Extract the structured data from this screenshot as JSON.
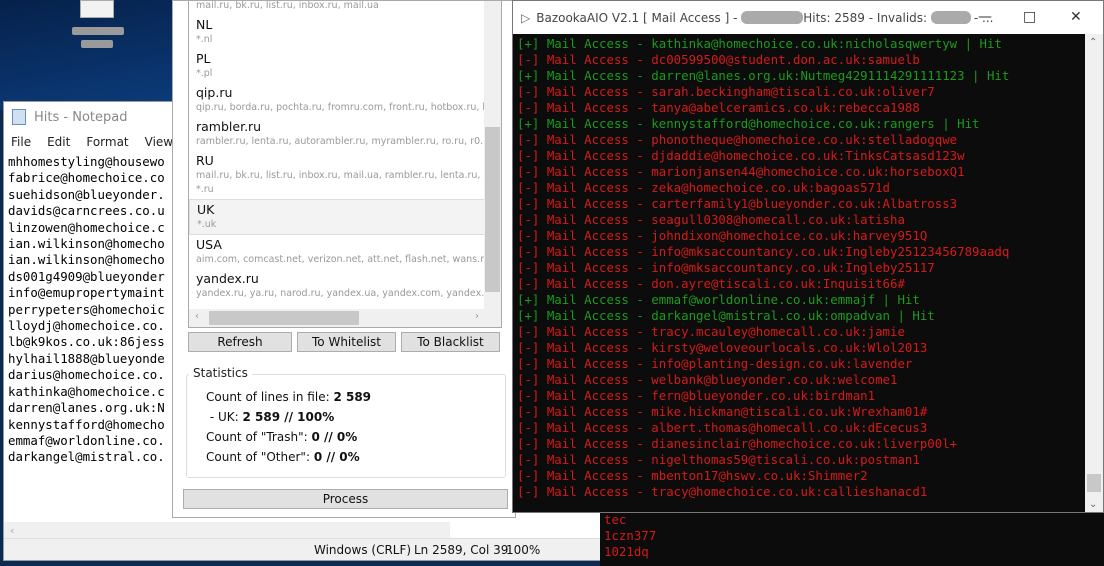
{
  "desktop_icon": {
    "label": "redacted"
  },
  "notepad": {
    "title": "Hits - Notepad",
    "menu": [
      "File",
      "Edit",
      "Format",
      "View",
      "H"
    ],
    "lines": [
      "mhhomestyling@housewo",
      "fabrice@homechoice.co",
      "suehidson@blueyonder.",
      "davids@carncrees.co.u",
      "linzowen@homechoice.c",
      "ian.wilkinson@homecho",
      "ian.wilkinson@homecho",
      "ds001g4909@blueyonder",
      "info@emupropertymaint",
      "perrypeters@homechoic",
      "lloydj@homechoice.co.",
      "lb@k9kos.co.uk:86jess",
      "hylhail1888@blueyonde",
      "darius@homechoice.co.",
      "kathinka@homechoice.c",
      "darren@lanes.org.uk:N",
      "kennystafford@homecho",
      "emmaf@worldonline.co.",
      "darkangel@mistral.co."
    ],
    "status": {
      "encoding": "Windows (CRLF)",
      "position": "Ln 2589, Col 39",
      "zoom": "100%"
    }
  },
  "background_console": {
    "lines": [
      "tec",
      "1czn377",
      "1021dq"
    ]
  },
  "sorter": {
    "list": [
      {
        "name": "",
        "domains": "mail.ru, bk.ru, list.ru, inbox.ru, mail.ua"
      },
      {
        "name": "NL",
        "domains": "*.nl"
      },
      {
        "name": "PL",
        "domains": "*.pl"
      },
      {
        "name": "qip.ru",
        "domains": "qip.ru, borda.ru, pochta.ru, fromru.com, front.ru, hotbox.ru, hotmail.ru"
      },
      {
        "name": "rambler.ru",
        "domains": "rambler.ru, lenta.ru, autorambler.ru, myrambler.ru, ro.ru, r0.ru, rambler.ua"
      },
      {
        "name": "RU",
        "domains": "mail.ru, bk.ru, list.ru, inbox.ru, mail.ua, rambler.ru, lenta.ru, autorambler.ru",
        "domains2": "*.ru"
      },
      {
        "name": "UK",
        "domains": "*.uk",
        "selected": true
      },
      {
        "name": "USA",
        "domains": "aim.com, comcast.net, verizon.net, att.net, flash.net, wans.net, talk21.com"
      },
      {
        "name": "yandex.ru",
        "domains": "yandex.ru, ya.ru, narod.ru, yandex.ua, yandex.com, yandex.by, yandex.kz"
      }
    ],
    "buttons": {
      "refresh": "Refresh",
      "whitelist": "To Whitelist",
      "blacklist": "To Blacklist",
      "process": "Process"
    },
    "statistics": {
      "title": "Statistics",
      "lines_label": "Count of lines in file: ",
      "lines_value": "2 589",
      "uk_label": " - UK: ",
      "uk_value": "2 589 // 100%",
      "trash_label": "Count of \"Trash\": ",
      "trash_value": "0 // 0%",
      "other_label": "Count of \"Other\": ",
      "other_value": "0 // 0%"
    }
  },
  "console": {
    "title_prefix": "BazookaAIO V2.1 [ Mail Access ] - ",
    "title_hits": "Hits: 2589 - Invalids: ",
    "title_suffix": "- ...",
    "colors": {
      "hit": "#1e9a1e",
      "fail": "#d61a1a"
    },
    "lines": [
      {
        "s": "+",
        "t": "[+] Mail Access - kathinka@homechoice.co.uk:nicholasqwertyw | Hit"
      },
      {
        "s": "-",
        "t": "[-] Mail Access - dc00599500@student.don.ac.uk:samuelb"
      },
      {
        "s": "+",
        "t": "[+] Mail Access - darren@lanes.org.uk:Nutmeg4291114291111123 | Hit"
      },
      {
        "s": "-",
        "t": "[-] Mail Access - sarah.beckingham@tiscali.co.uk:oliver7"
      },
      {
        "s": "-",
        "t": "[-] Mail Access - tanya@abelceramics.co.uk:rebecca1988"
      },
      {
        "s": "+",
        "t": "[+] Mail Access - kennystafford@homechoice.co.uk:rangers | Hit"
      },
      {
        "s": "-",
        "t": "[-] Mail Access - phonotheque@homechoice.co.uk:stelladogqwe"
      },
      {
        "s": "-",
        "t": "[-] Mail Access - djdaddie@homechoice.co.uk:TinksCatsasd123w"
      },
      {
        "s": "-",
        "t": "[-] Mail Access - marionjansen44@homechoice.co.uk:horseboxQ1"
      },
      {
        "s": "-",
        "t": "[-] Mail Access - zeka@homechoice.co.uk:bagoas571d"
      },
      {
        "s": "-",
        "t": "[-] Mail Access - carterfamily1@blueyonder.co.uk:Albatross3"
      },
      {
        "s": "-",
        "t": "[-] Mail Access - seagull0308@homecall.co.uk:latisha"
      },
      {
        "s": "-",
        "t": "[-] Mail Access - johndixon@homechoice.co.uk:harvey951Q"
      },
      {
        "s": "-",
        "t": "[-] Mail Access - info@mksaccountancy.co.uk:Ingleby25123456789aadq"
      },
      {
        "s": "-",
        "t": "[-] Mail Access - info@mksaccountancy.co.uk:Ingleby25117"
      },
      {
        "s": "-",
        "t": "[-] Mail Access - don.ayre@tiscali.co.uk:Inquisit66#"
      },
      {
        "s": "+",
        "t": "[+] Mail Access - emmaf@worldonline.co.uk:emmajf | Hit"
      },
      {
        "s": "+",
        "t": "[+] Mail Access - darkangel@mistral.co.uk:ompadvan | Hit"
      },
      {
        "s": "-",
        "t": "[-] Mail Access - tracy.mcauley@homecall.co.uk:jamie"
      },
      {
        "s": "-",
        "t": "[-] Mail Access - kirsty@weloveourlocals.co.uk:Wlol2013"
      },
      {
        "s": "-",
        "t": "[-] Mail Access - info@planting-design.co.uk:lavender"
      },
      {
        "s": "-",
        "t": "[-] Mail Access - welbank@blueyonder.co.uk:welcome1"
      },
      {
        "s": "-",
        "t": "[-] Mail Access - fern@blueyonder.co.uk:birdman1"
      },
      {
        "s": "-",
        "t": "[-] Mail Access - mike.hickman@tiscali.co.uk:Wrexham01#"
      },
      {
        "s": "-",
        "t": "[-] Mail Access - albert.thomas@homecall.co.uk:dEcecus3"
      },
      {
        "s": "-",
        "t": "[-] Mail Access - dianesinclair@homechoice.co.uk:liverp00l+"
      },
      {
        "s": "-",
        "t": "[-] Mail Access - nigelthomas59@tiscali.co.uk:postman1"
      },
      {
        "s": "-",
        "t": "[-] Mail Access - mbenton17@hswv.co.uk:Shimmer2"
      },
      {
        "s": "-",
        "t": "[-] Mail Access - tracy@homechoice.co.uk:callieshanacd1"
      }
    ]
  }
}
